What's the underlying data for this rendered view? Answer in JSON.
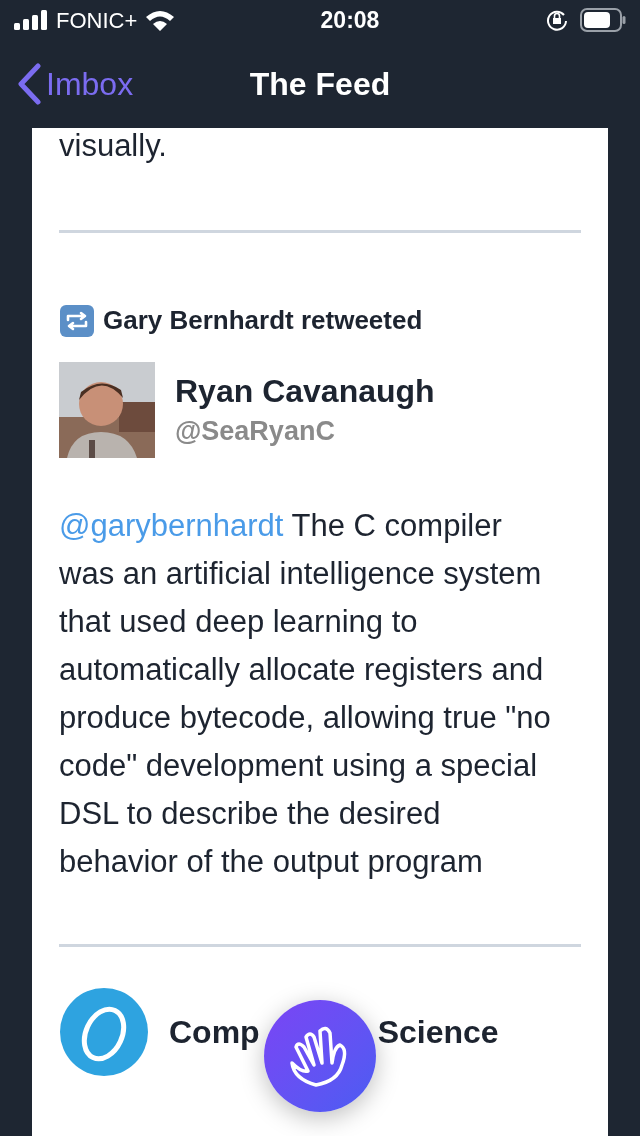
{
  "status_bar": {
    "carrier": "FONIC+",
    "time": "20:08"
  },
  "nav": {
    "back_label": "Imbox",
    "title": "The Feed"
  },
  "feed": {
    "previous_tail": "visually.",
    "items": [
      {
        "kind": "retweet",
        "retweeted_by": "Gary Bernhardt retweeted",
        "name": "Ryan Cavanaugh",
        "handle": "@SeaRyanC",
        "mention": "@garybernhardt",
        "text": "The C compiler was an artificial intelligence system that used deep learning to automatically allocate registers and produce bytecode, allowing true \"no code\" development using a special DSL to describe the desired behavior of the output program"
      },
      {
        "kind": "tweet",
        "name_parts": [
          "Comp",
          "Science"
        ]
      }
    ]
  }
}
